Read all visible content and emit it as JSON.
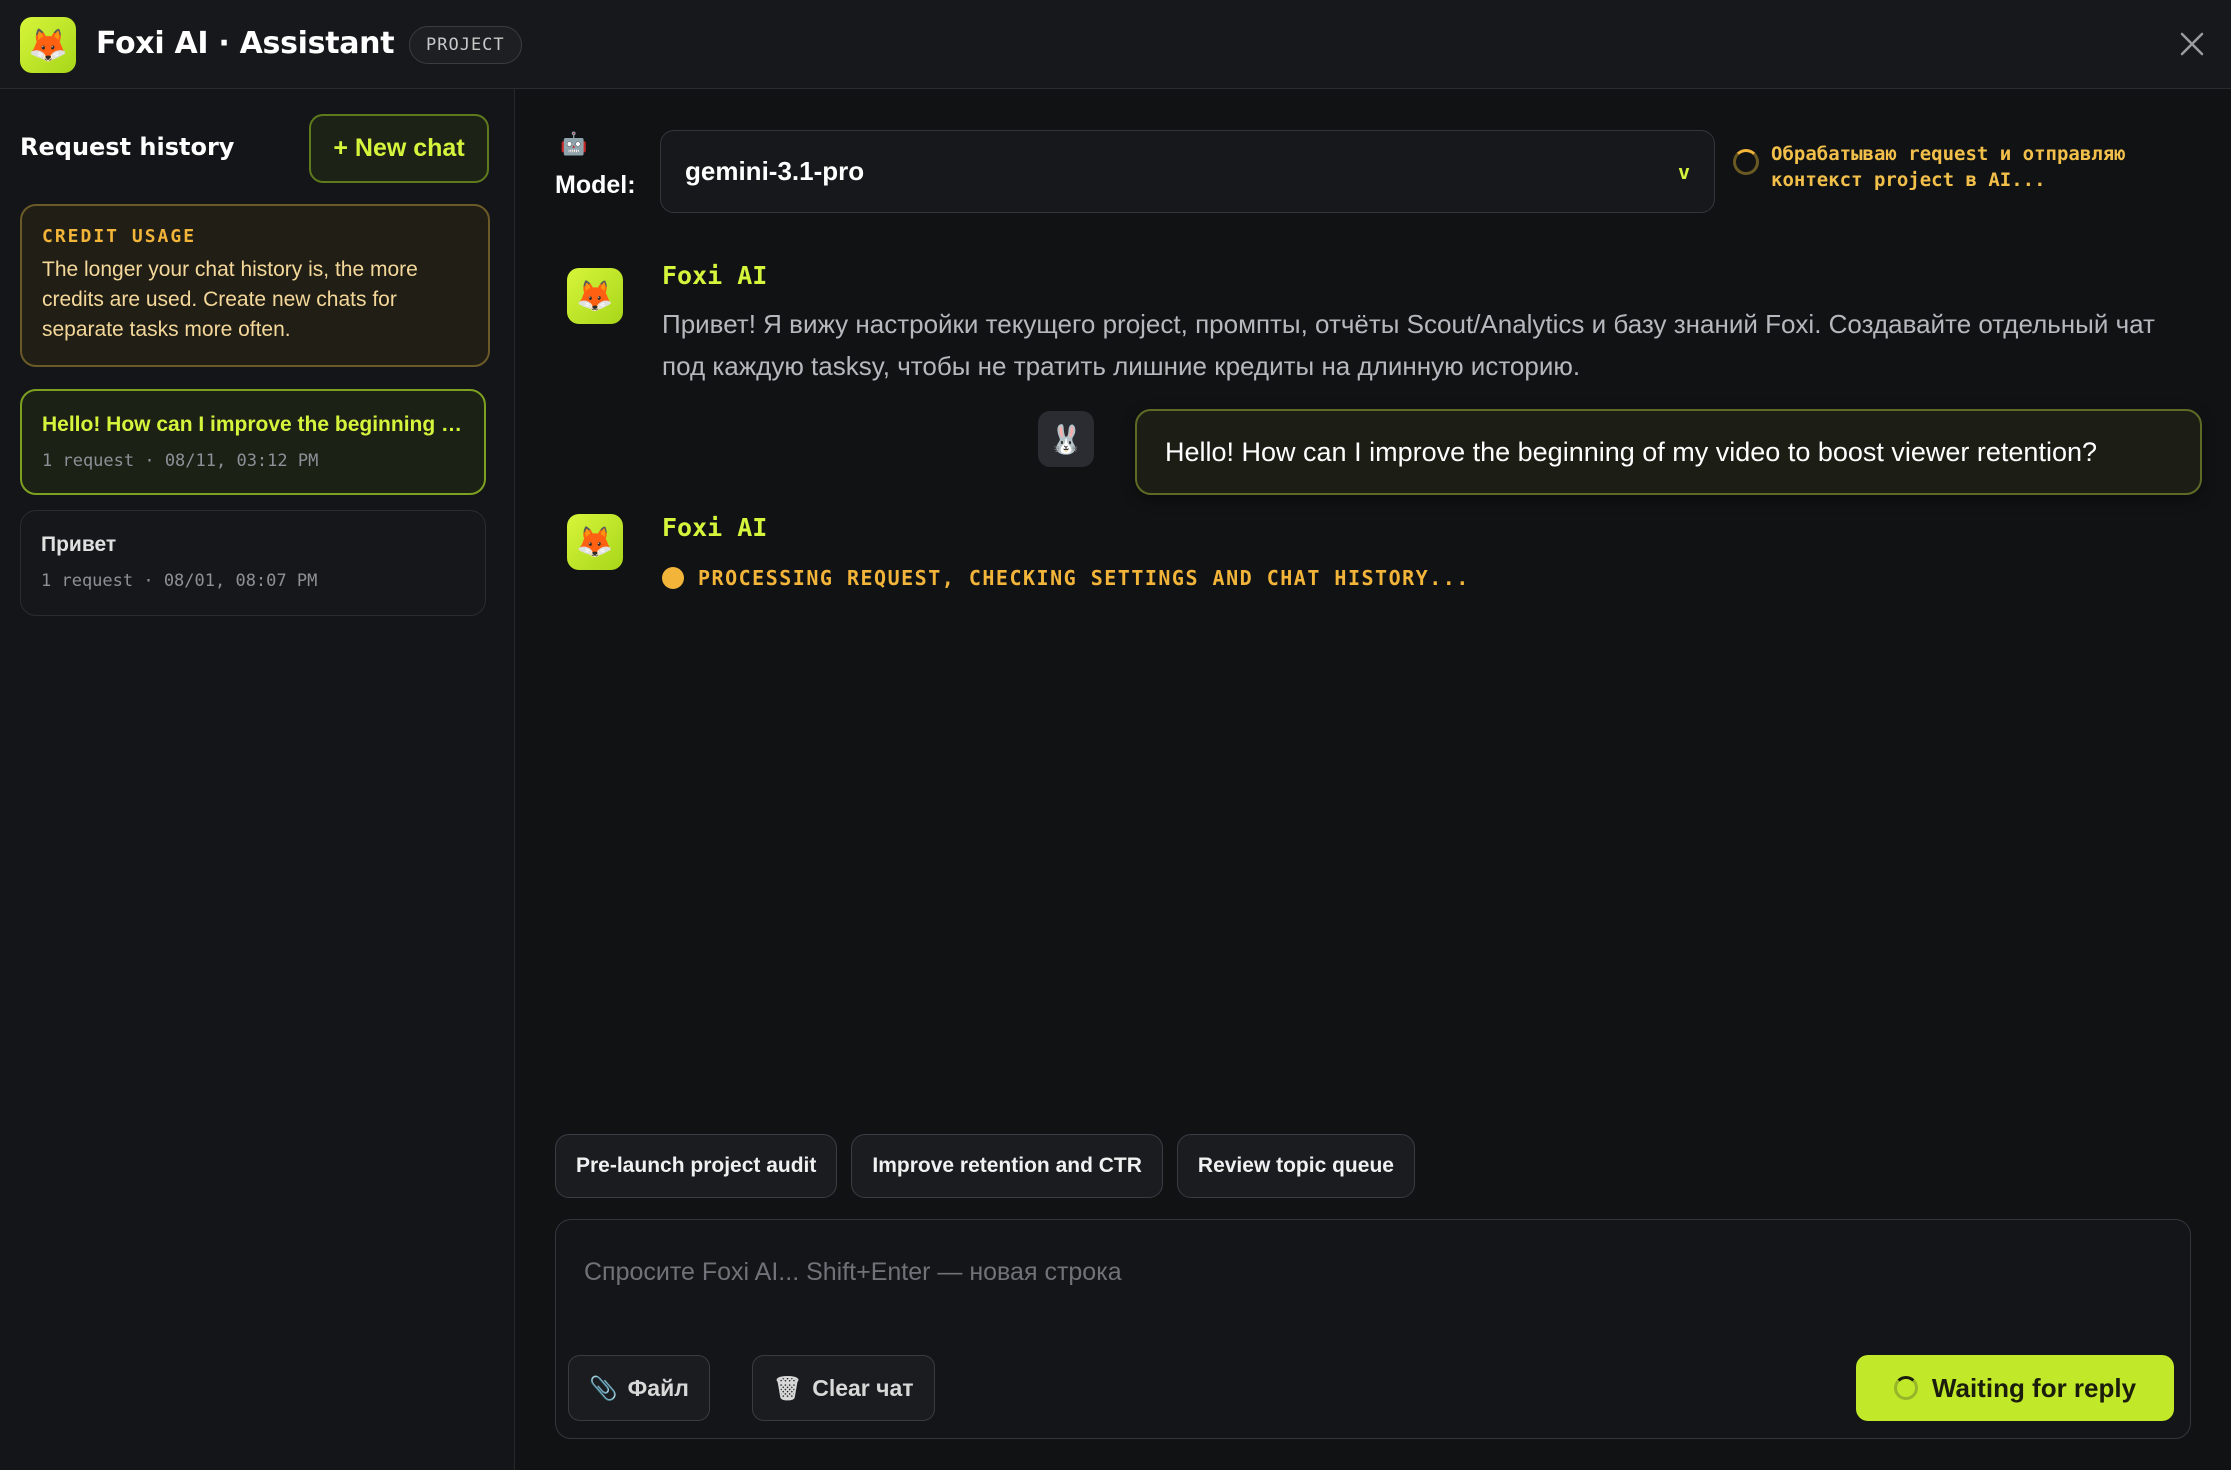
{
  "header": {
    "logo_emoji": "🦊",
    "title": "Foxi AI · Assistant",
    "badge": "PROJECT",
    "close_icon": "close-icon"
  },
  "sidebar": {
    "title": "Request history",
    "new_chat_label": "+ New chat",
    "credit": {
      "label": "CREDIT USAGE",
      "text": "The longer your chat history is, the more credits are used. Create new chats for separate tasks more often."
    },
    "chats": [
      {
        "title": "Hello! How can I improve the beginning of my video to boost viewer retention?",
        "meta": "1 request · 08/11, 03:12 PM",
        "active": true
      },
      {
        "title": "Привет",
        "meta": "1 request · 08/01, 08:07 PM",
        "active": false
      }
    ]
  },
  "model": {
    "icon_emoji": "🤖",
    "label": "Model:",
    "value": "gemini-3.1-pro",
    "chevron": "v",
    "status": "Обрабатываю request и отправляю контекст project в AI..."
  },
  "messages": {
    "bot_name": "Foxi AI",
    "bot_emoji": "🦊",
    "user_emoji": "🐰",
    "greeting": "Привет! Я вижу настройки текущего project, промпты, отчёты Scout/Analytics и базу знаний Foxi. Создавайте отдельный чат под каждую tasksy, чтобы не тратить лишние кредиты на длинную историю.",
    "user_message": "Hello! How can I improve the beginning of my video to boost viewer retention?",
    "processing": "PROCESSING REQUEST, CHECKING SETTINGS AND CHAT HISTORY..."
  },
  "chips": [
    "Pre-launch project audit",
    "Improve retention and CTR",
    "Review topic queue"
  ],
  "composer": {
    "placeholder": "Спросите Foxi AI... Shift+Enter — новая строка",
    "value": "",
    "file_label": "Файл",
    "file_emoji": "📎",
    "clear_label": "Clear чат",
    "clear_emoji": "🗑",
    "send_label": "Waiting for reply"
  },
  "colors": {
    "accent": "#d4f53c",
    "warning": "#f2b53a",
    "background": "#111214"
  }
}
